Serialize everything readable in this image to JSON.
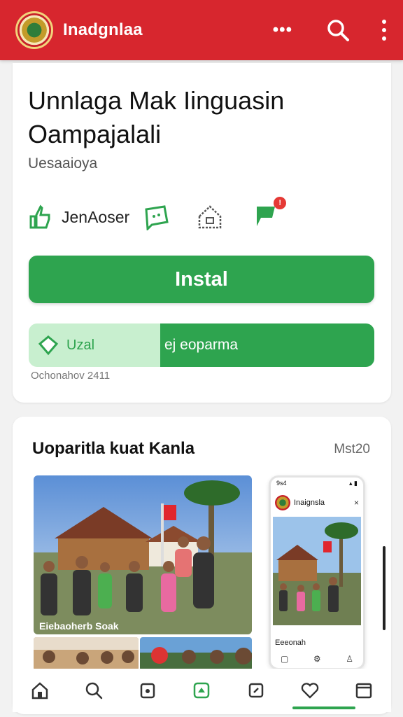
{
  "app": {
    "title": "Inadgnlaa",
    "menu_dots": "•••"
  },
  "hero": {
    "title": "Unnlaga Mak Iinguasin Oampajalali",
    "subtitle": "Uesaaioya",
    "feature_label": "JenAoser",
    "notification_badge": "!"
  },
  "actions": {
    "install_label": "Instal",
    "split_left_label": "Uzal",
    "split_right_label": "ej eoparma",
    "updated_text": "Ochonahov 2411"
  },
  "screenshots": {
    "section_title": "Uoparitla kuat Kanla",
    "section_more": "Mst20",
    "photo_caption": "Eiebaoherb Soak",
    "phone": {
      "status_left": "9s4",
      "status_right": "▴ ▮",
      "title": "Inaignsla",
      "close": "×",
      "label": "Eeeonah"
    }
  },
  "colors": {
    "appbar": "#d7262e",
    "accent_green": "#2ea44f",
    "light_green": "#c8efcf",
    "badge_red": "#e53935"
  },
  "icons": [
    "search-icon",
    "kebab-icon",
    "thumbs-icon",
    "chat-icon",
    "house-icon",
    "flag-icon",
    "home-icon",
    "search-nav-icon",
    "apps-icon",
    "games-icon",
    "books-icon",
    "heart-icon",
    "library-icon"
  ]
}
